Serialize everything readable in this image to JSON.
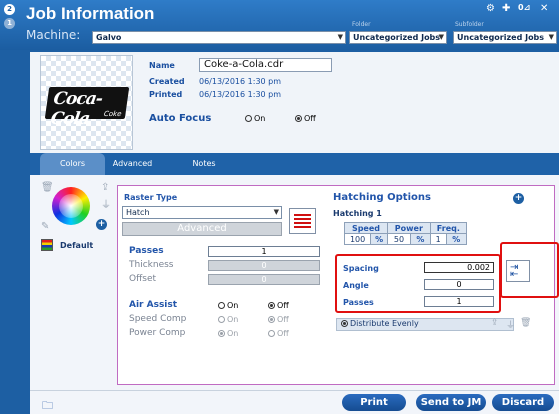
{
  "header": {
    "title": "Job Information",
    "machine_label": "Machine:",
    "machine_value": "Galvo",
    "folder_caption": "Folder",
    "folder_value": "Uncategorized Jobs",
    "subfolder_caption": "Subfolder",
    "subfolder_value": "Uncategorized Jobs",
    "steps": [
      "2",
      "1"
    ],
    "top_icons": [
      "gear-icon",
      "pin-icon",
      "zero-pan-icon",
      "close-icon"
    ]
  },
  "job": {
    "name_label": "Name",
    "name_value": "Coke-a-Cola.cdr",
    "created_label": "Created",
    "created_value": "06/13/2016 1:30 pm",
    "printed_label": "Printed",
    "printed_value": "06/13/2016 1:30 pm",
    "autofocus_label": "Auto Focus",
    "autofocus_on": "On",
    "autofocus_off": "Off",
    "autofocus_selected": "Off",
    "logo_text": "Coca-Cola",
    "logo_sub": "Coke"
  },
  "tabs": [
    {
      "label": "Colors"
    },
    {
      "label": "Advanced"
    },
    {
      "label": "Notes"
    }
  ],
  "colors": {
    "default_label": "Default"
  },
  "raster": {
    "type_label": "Raster Type",
    "type_value": "Hatch",
    "advanced_button": "Advanced",
    "passes_label": "Passes",
    "passes_value": "1",
    "thickness_label": "Thickness",
    "thickness_value": "0",
    "offset_label": "Offset",
    "offset_value": "0",
    "air_assist_label": "Air Assist",
    "air_assist_selected": "Off",
    "speed_comp_label": "Speed Comp",
    "speed_comp_selected": "Off",
    "power_comp_label": "Power Comp",
    "power_comp_selected": "On",
    "on": "On",
    "off": "Off"
  },
  "hatching": {
    "title": "Hatching Options",
    "subtitle": "Hatching 1",
    "headers": [
      "Speed",
      "Power",
      "Freq."
    ],
    "values": [
      "100",
      "%",
      "50",
      "%",
      "1",
      "%"
    ],
    "spacing_label": "Spacing",
    "spacing_value": "0.002",
    "angle_label": "Angle",
    "angle_value": "0",
    "passes_label": "Passes",
    "passes_value": "1",
    "distribute_label": "Distribute Evenly"
  },
  "footer": {
    "print": "Print",
    "send": "Send to JM",
    "discard": "Discard"
  }
}
